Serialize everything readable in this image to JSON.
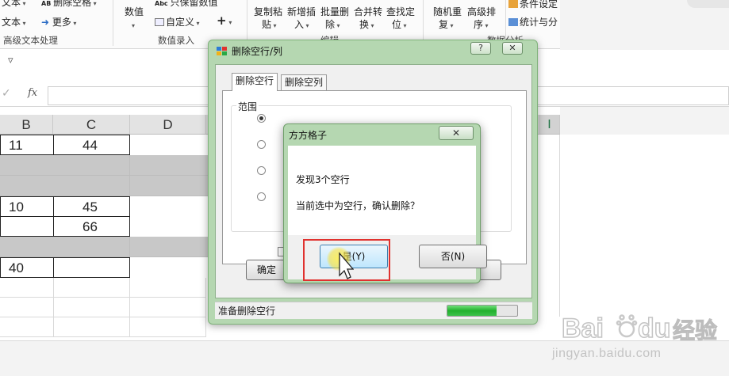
{
  "ribbon": {
    "row1": {
      "c0": "文本",
      "c1": "删除空格",
      "c2": "只保留数值",
      "c3": "复制粘",
      "c4": "新增插",
      "c5": "批量删",
      "c6": "合并转",
      "c7": "查找定",
      "c8": "随机重",
      "c9": "高级排",
      "c10": "条件设定"
    },
    "row2": {
      "c0": "文本",
      "c1": "更多",
      "c2": "数值",
      "c3": "自定义",
      "c4": "+",
      "c5": "贴",
      "c6": "入",
      "c7": "除",
      "c8": "换",
      "c9": "位",
      "c10": "复",
      "c11": "序",
      "c12": "统计与分"
    },
    "groups": {
      "advanced_text": "高级文本处理",
      "number_entry": "数值录入",
      "edit": "编辑",
      "data_analysis": "数据分析"
    }
  },
  "quick_access": {
    "dropdown": "▿"
  },
  "formula_bar": {
    "cancel": "✓",
    "fx": "fx"
  },
  "grid": {
    "columns": [
      "B",
      "C",
      "D",
      "I"
    ],
    "cells": {
      "b1": "11",
      "c1": "44",
      "b4": "10",
      "c4": "45",
      "c5": "66",
      "b7": "40"
    }
  },
  "dialog": {
    "title": "删除空行/列",
    "help_button": "?",
    "close_button": "✕",
    "tabs": [
      "删除空行",
      "删除空列"
    ],
    "range_label": "范围",
    "confirm_button": "确定",
    "status_text": "准备删除空行",
    "progress_pct": 70
  },
  "message_box": {
    "title": "方方格子",
    "close_button": "✕",
    "line1": "发现3个空行",
    "line2": "当前选中为空行，确认删除？",
    "yes_button": "是(Y)",
    "no_button": "否(N)"
  },
  "watermark": {
    "brand": "Baidu 经验",
    "url": "jingyan.baidu.com"
  },
  "colors": {
    "dialog_frame": "#b5d7b1",
    "header_selected_text": "#217346",
    "empty_row_fill": "#c8c8c8",
    "highlight_box": "#e0322f"
  }
}
